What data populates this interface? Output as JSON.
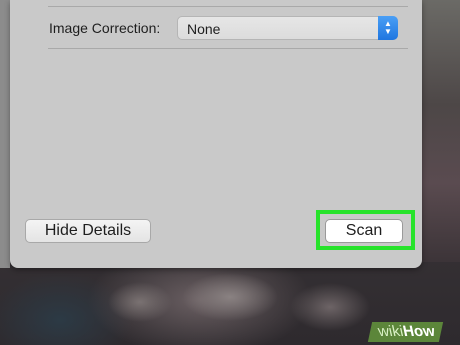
{
  "dialog": {
    "image_correction": {
      "label": "Image Correction:",
      "value": "None"
    },
    "buttons": {
      "hide_details": "Hide Details",
      "scan": "Scan"
    }
  },
  "watermark": {
    "brand_prefix": "wiki",
    "brand_suffix": "How"
  },
  "colors": {
    "highlight": "#27e32b",
    "stepper_accent": "#1f76e0",
    "panel_bg": "#c9c9c9"
  },
  "icons": {
    "stepper": "chevron-up-down-icon"
  }
}
